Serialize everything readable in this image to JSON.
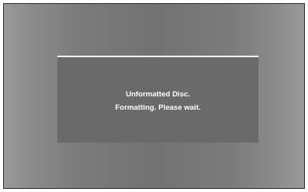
{
  "dialog": {
    "line1": "Unformatted Disc.",
    "line2": "Formatting. Please wait."
  }
}
